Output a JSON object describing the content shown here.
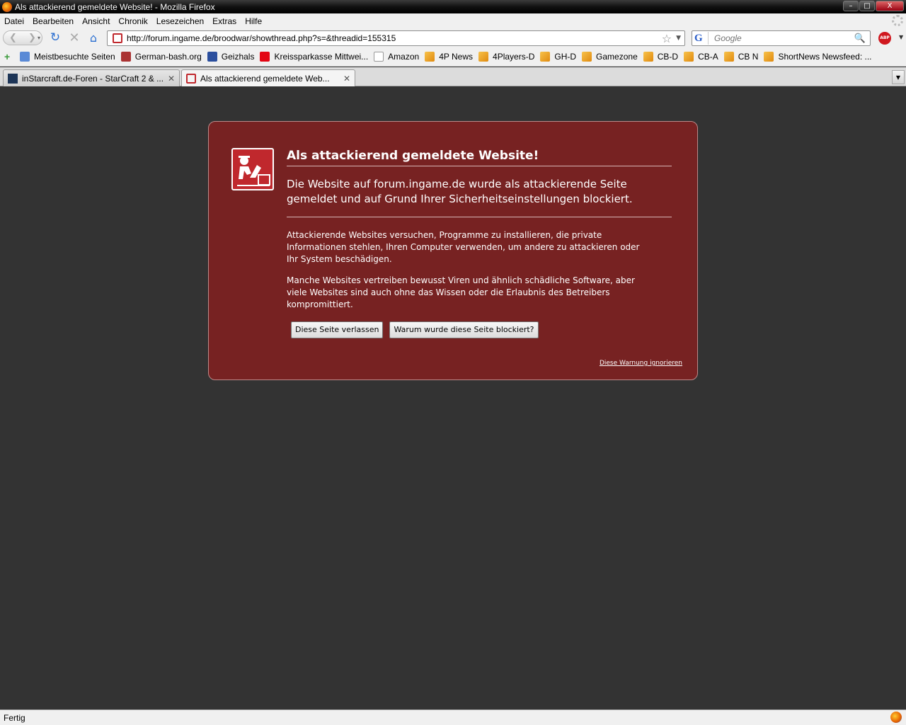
{
  "window": {
    "title": "Als attackierend gemeldete Website! - Mozilla Firefox",
    "buttons": [
      "–",
      "□",
      "X"
    ]
  },
  "menubar": [
    "Datei",
    "Bearbeiten",
    "Ansicht",
    "Chronik",
    "Lesezeichen",
    "Extras",
    "Hilfe"
  ],
  "navbar": {
    "url": "http://forum.ingame.de/broodwar/showthread.php?s=&threadid=155315",
    "search_placeholder": "Google",
    "abp_label": "ABP"
  },
  "bookmarks": [
    {
      "label": "Meistbesuchte Seiten",
      "icon": "folder-icon"
    },
    {
      "label": "German-bash.org",
      "icon": "bash-icon"
    },
    {
      "label": "Geizhals",
      "icon": "geizhals-icon"
    },
    {
      "label": "Kreissparkasse Mittwei...",
      "icon": "sparkasse-icon"
    },
    {
      "label": "Amazon",
      "icon": "amazon-icon"
    },
    {
      "label": "4P News",
      "icon": "rss-icon"
    },
    {
      "label": "4Players-D",
      "icon": "rss-icon"
    },
    {
      "label": "GH-D",
      "icon": "rss-icon"
    },
    {
      "label": "Gamezone",
      "icon": "rss-icon"
    },
    {
      "label": "CB-D",
      "icon": "rss-icon"
    },
    {
      "label": "CB-A",
      "icon": "rss-icon"
    },
    {
      "label": "CB N",
      "icon": "rss-icon"
    },
    {
      "label": "ShortNews Newsfeed: ...",
      "icon": "rss-icon"
    }
  ],
  "tabs": [
    {
      "label": "inStarcraft.de-Foren - StarCraft 2 & ...",
      "active": false
    },
    {
      "label": "Als attackierend gemeldete Web...",
      "active": true
    }
  ],
  "error": {
    "title": "Als attackierend gemeldete Website!",
    "short_desc": "Die Website auf forum.ingame.de wurde als attackierende Seite gemeldet und auf Grund Ihrer Sicherheitseinstellungen blockiert.",
    "paragraph1": "Attackierende Websites versuchen, Programme zu installieren, die private Informationen stehlen, Ihren Computer verwenden, um andere zu attackieren oder Ihr System beschädigen.",
    "paragraph2": "Manche Websites vertreiben bewusst Viren und ähnlich schädliche Software, aber viele Websites sind auch ohne das Wissen oder die Erlaubnis des Betreibers kompromittiert.",
    "btn_leave": "Diese Seite verlassen",
    "btn_why": "Warum wurde diese Seite blockiert?",
    "ignore_link": "Diese Warnung ignorieren"
  },
  "status": {
    "text": "Fertig"
  },
  "colors": {
    "error_bg": "#772222",
    "page_bg": "#333333"
  }
}
